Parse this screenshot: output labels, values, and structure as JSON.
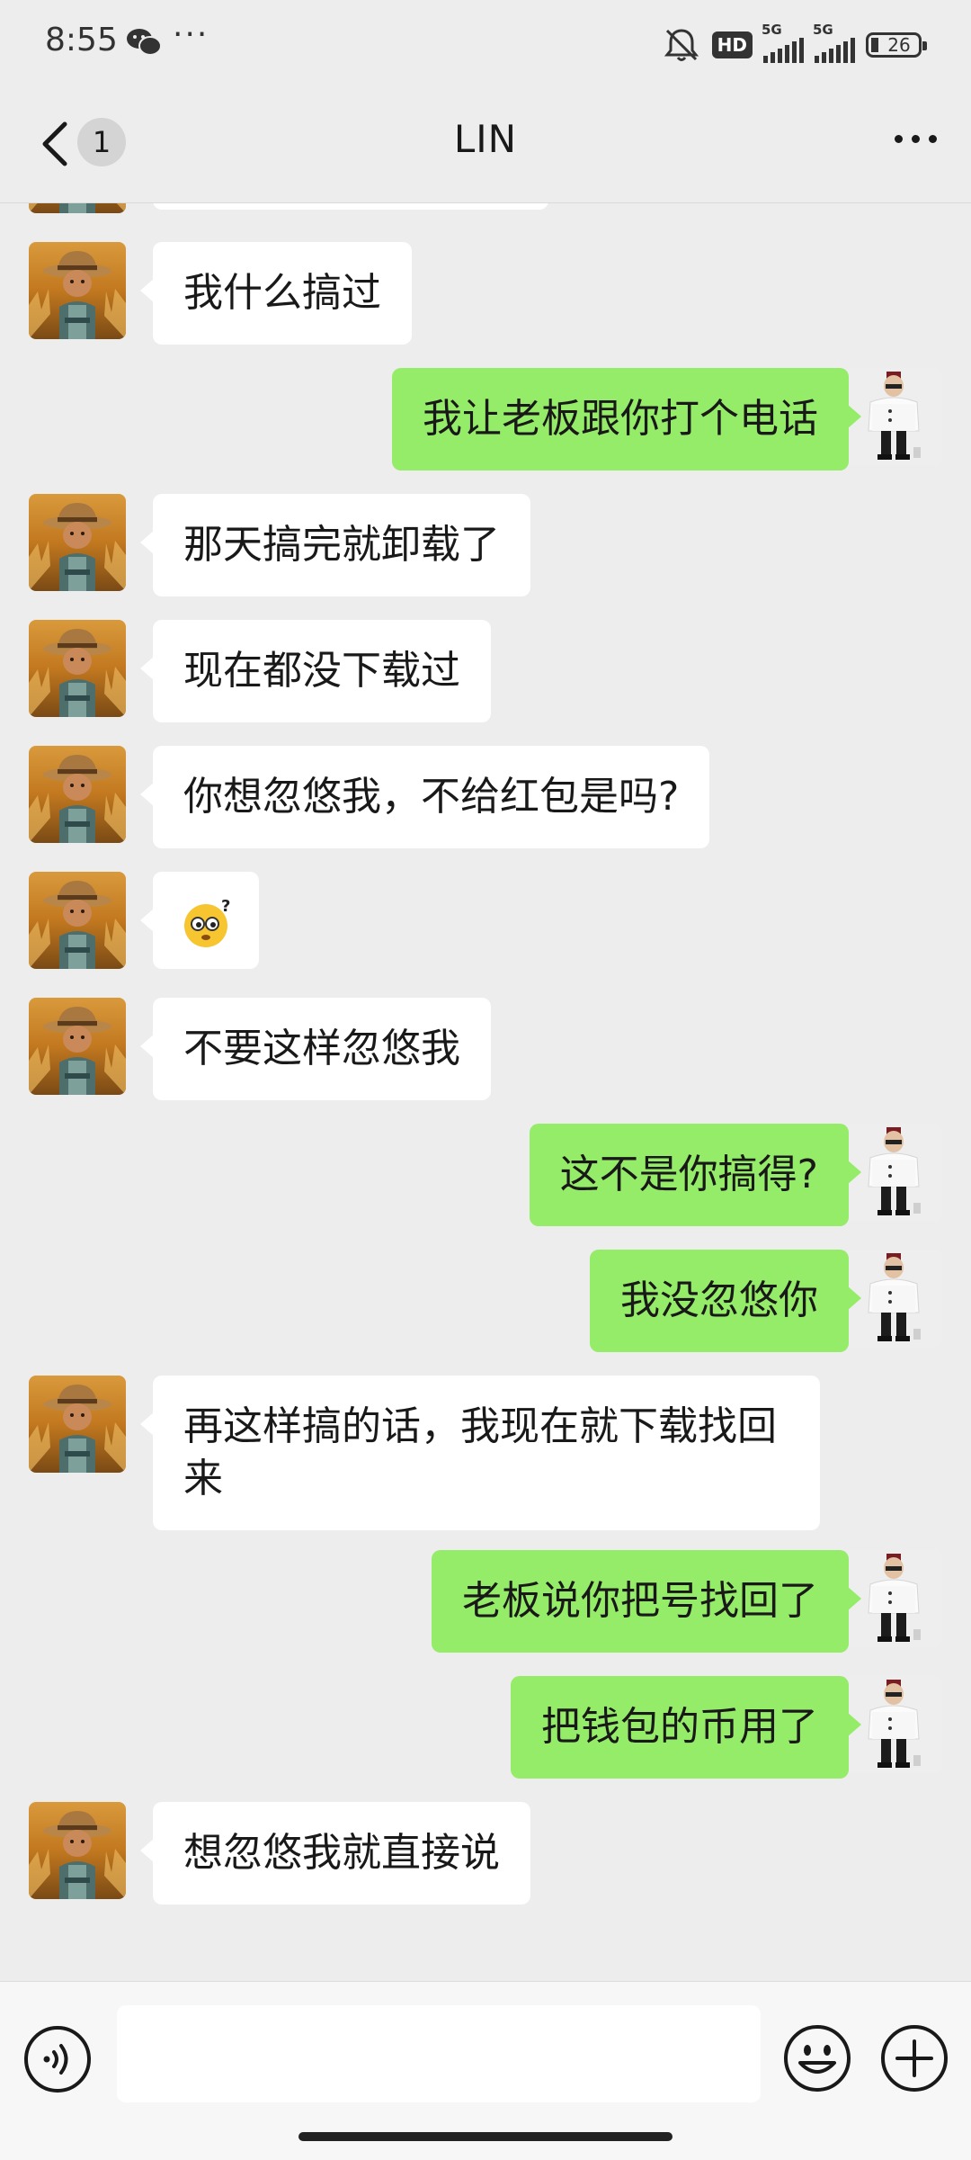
{
  "status_bar": {
    "time": "8:55",
    "more_indicator": "···",
    "network_badge": "HD",
    "signal_1": "5G",
    "signal_2": "5G",
    "battery": "26",
    "icons": [
      "wechat-notification-icon",
      "mute-icon",
      "signal-icon",
      "battery-icon"
    ]
  },
  "header": {
    "unread_count": "1",
    "title": "LIN",
    "icons": [
      "back-arrow-icon",
      "more-options-icon"
    ]
  },
  "messages": [
    {
      "side": "left",
      "text": "我什么搞过"
    },
    {
      "side": "right",
      "text": "我让老板跟你打个电话"
    },
    {
      "side": "left",
      "text": "那天搞完就卸载了"
    },
    {
      "side": "left",
      "text": "现在都没下载过"
    },
    {
      "side": "left",
      "text": "你想忽悠我，不给红包是吗?"
    },
    {
      "side": "left",
      "emoji": "confused-face-emoji"
    },
    {
      "side": "left",
      "text": "不要这样忽悠我"
    },
    {
      "side": "right",
      "text": "这不是你搞得?"
    },
    {
      "side": "right",
      "text": "我没忽悠你"
    },
    {
      "side": "left",
      "text": "再这样搞的话，我现在就下载找回来"
    },
    {
      "side": "right",
      "text": "老板说你把号找回了"
    },
    {
      "side": "right",
      "text": "把钱包的币用了"
    },
    {
      "side": "left",
      "text": "想忽悠我就直接说"
    }
  ],
  "input_bar": {
    "input_value": "",
    "icons": [
      "voice-icon",
      "emoji-icon",
      "plus-icon"
    ]
  },
  "colors": {
    "background": "#ededed",
    "incoming_bubble": "#ffffff",
    "outgoing_bubble": "#95ec69"
  }
}
